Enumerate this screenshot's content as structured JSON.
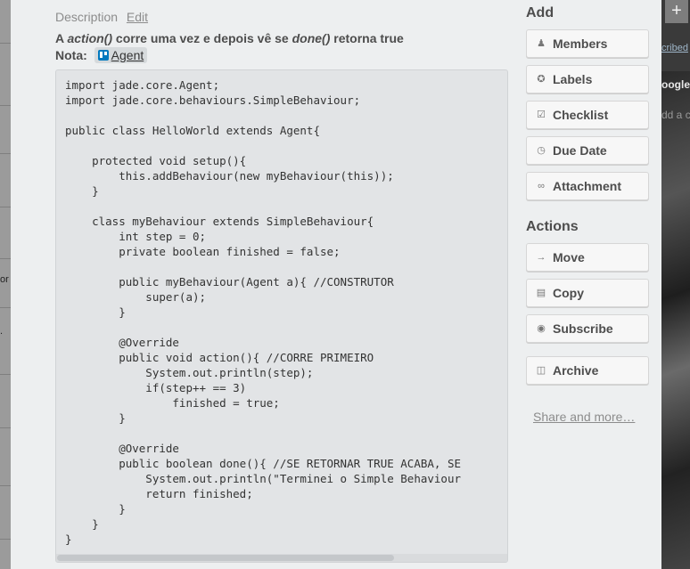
{
  "description": {
    "header": "Description",
    "edit_label": "Edit",
    "line1": {
      "prefix": "A ",
      "em1": "action()",
      "mid": " corre uma vez e depois vê se ",
      "em2": "done()",
      "suffix": " retorna true"
    },
    "nota_label": "Nota:",
    "chip_label": "Agent",
    "code": "import jade.core.Agent;\nimport jade.core.behaviours.SimpleBehaviour;\n\npublic class HelloWorld extends Agent{\n\n    protected void setup(){\n        this.addBehaviour(new myBehaviour(this));\n    }\n\n    class myBehaviour extends SimpleBehaviour{\n        int step = 0;\n        private boolean finished = false;\n\n        public myBehaviour(Agent a){ //CONSTRUTOR\n            super(a);\n        }\n\n        @Override\n        public void action(){ //CORRE PRIMEIRO\n            System.out.println(step);\n            if(step++ == 3)\n                finished = true;\n        }\n\n        @Override\n        public boolean done(){ //SE RETORNAR TRUE ACABA, SE\n            System.out.println(\"Terminei o Simple Behaviour\n            return finished;\n        }\n    }\n}"
  },
  "sidebar": {
    "add_title": "Add",
    "add_buttons": [
      {
        "label": "Members",
        "icon": "person-icon"
      },
      {
        "label": "Labels",
        "icon": "label-icon"
      },
      {
        "label": "Checklist",
        "icon": "checklist-icon"
      },
      {
        "label": "Due Date",
        "icon": "clock-icon"
      },
      {
        "label": "Attachment",
        "icon": "paperclip-icon"
      }
    ],
    "actions_title": "Actions",
    "action_buttons": [
      {
        "label": "Move",
        "icon": "arrow-right-icon"
      },
      {
        "label": "Copy",
        "icon": "copy-icon"
      },
      {
        "label": "Subscribe",
        "icon": "eye-icon"
      },
      {
        "label": "Archive",
        "icon": "archive-icon"
      }
    ],
    "share_link": "Share and more…"
  },
  "background": {
    "left_fragments": [
      "or",
      "."
    ],
    "right_fragments": [
      "cribed",
      "oogle",
      "dd a c"
    ],
    "plus_label": "+"
  }
}
